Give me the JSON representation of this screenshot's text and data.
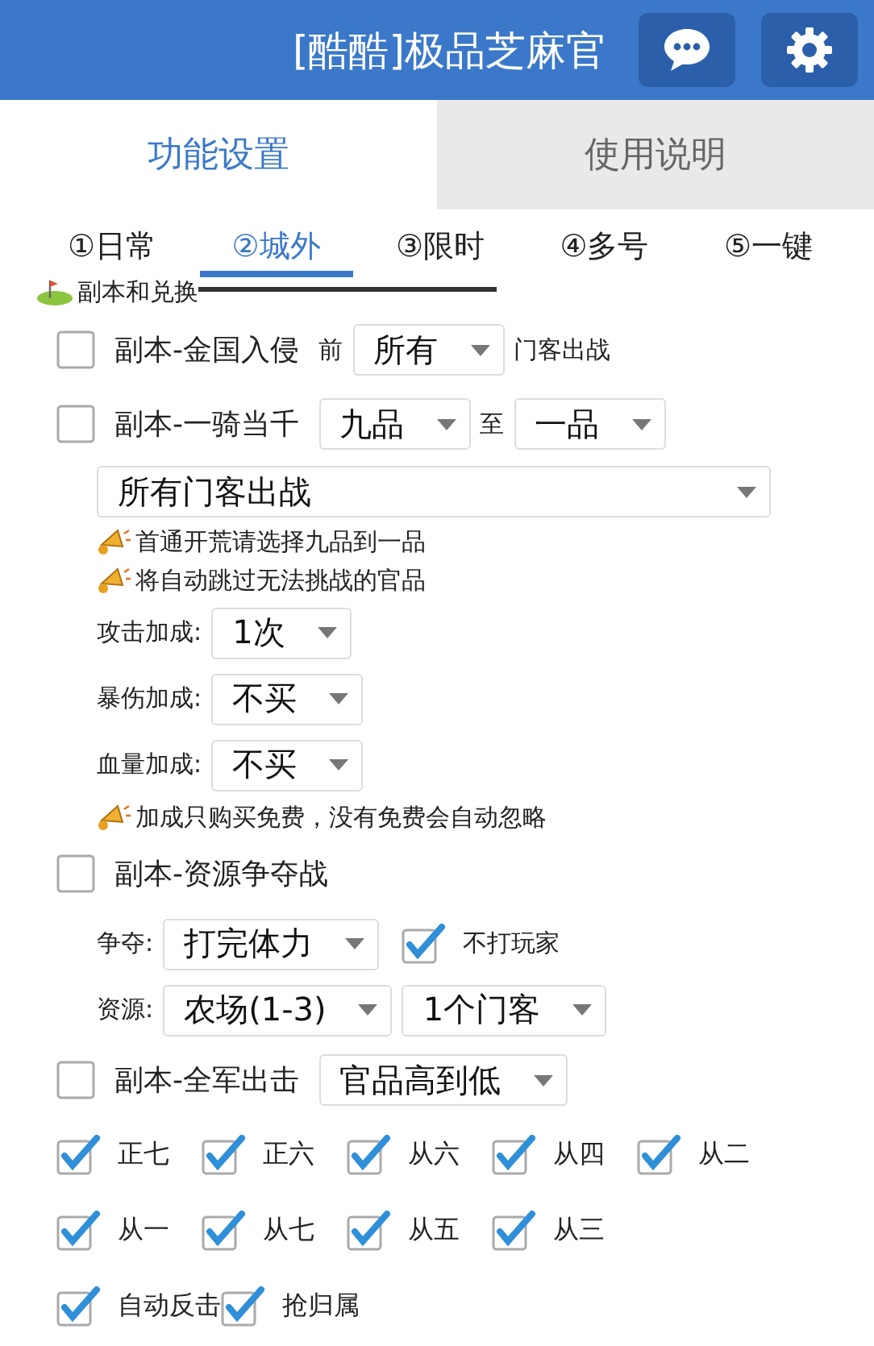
{
  "header": {
    "title": "[酷酷]极品芝麻官"
  },
  "main_tabs": [
    {
      "label": "功能设置",
      "selected": true
    },
    {
      "label": "使用说明",
      "selected": false
    }
  ],
  "sub_tabs": [
    {
      "label": "①日常",
      "selected": false
    },
    {
      "label": "②城外",
      "selected": true
    },
    {
      "label": "③限时",
      "selected": false
    },
    {
      "label": "④多号",
      "selected": false
    },
    {
      "label": "⑤一键",
      "selected": false
    }
  ],
  "section": {
    "title": "副本和兑换"
  },
  "rows": [
    {
      "kind": "option",
      "parts": [
        {
          "kind": "checkbox",
          "checked": false,
          "label": "副本-金国入侵"
        },
        {
          "kind": "text",
          "text": "前"
        },
        {
          "kind": "select",
          "value": "所有"
        },
        {
          "kind": "text",
          "text": "门客出战"
        }
      ]
    },
    {
      "kind": "option",
      "parts": [
        {
          "kind": "checkbox",
          "checked": false,
          "label": "副本-一骑当千"
        },
        {
          "kind": "select",
          "value": "九品"
        },
        {
          "kind": "text",
          "text": "至"
        },
        {
          "kind": "select",
          "value": "一品"
        }
      ]
    },
    {
      "kind": "wide",
      "parts": [
        {
          "kind": "select",
          "value": "所有门客出战"
        }
      ]
    },
    {
      "kind": "note",
      "parts": [
        {
          "kind": "text",
          "text": "首通开荒请选择九品到一品"
        }
      ]
    },
    {
      "kind": "note",
      "parts": [
        {
          "kind": "text",
          "text": "将自动跳过无法挑战的官品"
        }
      ]
    },
    {
      "kind": "field",
      "parts": [
        {
          "kind": "text",
          "text": "攻击加成:"
        },
        {
          "kind": "select",
          "value": "1次"
        }
      ]
    },
    {
      "kind": "field",
      "parts": [
        {
          "kind": "text",
          "text": "暴伤加成:"
        },
        {
          "kind": "select",
          "value": "不买"
        }
      ]
    },
    {
      "kind": "field",
      "parts": [
        {
          "kind": "text",
          "text": "血量加成:"
        },
        {
          "kind": "select",
          "value": "不买"
        }
      ]
    },
    {
      "kind": "note",
      "parts": [
        {
          "kind": "text",
          "text": "加成只购买免费，没有免费会自动忽略"
        }
      ]
    },
    {
      "kind": "option",
      "parts": [
        {
          "kind": "checkbox",
          "checked": false,
          "label": "副本-资源争夺战"
        }
      ]
    },
    {
      "kind": "field",
      "parts": [
        {
          "kind": "text",
          "text": "争夺:"
        },
        {
          "kind": "select",
          "value": "打完体力"
        },
        {
          "kind": "checkbox",
          "checked": true,
          "label": "不打玩家"
        }
      ]
    },
    {
      "kind": "field",
      "parts": [
        {
          "kind": "text",
          "text": "资源:"
        },
        {
          "kind": "select",
          "value": "农场(1-3)"
        },
        {
          "kind": "select",
          "value": "1个门客"
        }
      ]
    },
    {
      "kind": "option",
      "parts": [
        {
          "kind": "checkbox",
          "checked": false,
          "label": "副本-全军出击"
        },
        {
          "kind": "select",
          "value": "官品高到低"
        }
      ]
    },
    {
      "kind": "checks",
      "parts": [
        {
          "kind": "checkbox",
          "checked": true,
          "label": "正七"
        },
        {
          "kind": "checkbox",
          "checked": true,
          "label": "正六"
        },
        {
          "kind": "checkbox",
          "checked": true,
          "label": "从六"
        },
        {
          "kind": "checkbox",
          "checked": true,
          "label": "从四"
        },
        {
          "kind": "checkbox",
          "checked": true,
          "label": "从二"
        }
      ]
    },
    {
      "kind": "checks",
      "parts": [
        {
          "kind": "checkbox",
          "checked": true,
          "label": "从一"
        },
        {
          "kind": "checkbox",
          "checked": true,
          "label": "从七"
        },
        {
          "kind": "checkbox",
          "checked": true,
          "label": "从五"
        },
        {
          "kind": "checkbox",
          "checked": true,
          "label": "从三"
        }
      ]
    },
    {
      "kind": "checks",
      "parts": [
        {
          "kind": "checkbox",
          "checked": true,
          "label": "自动反击"
        },
        {
          "kind": "checkbox",
          "checked": true,
          "label": "抢归属"
        }
      ]
    }
  ]
}
